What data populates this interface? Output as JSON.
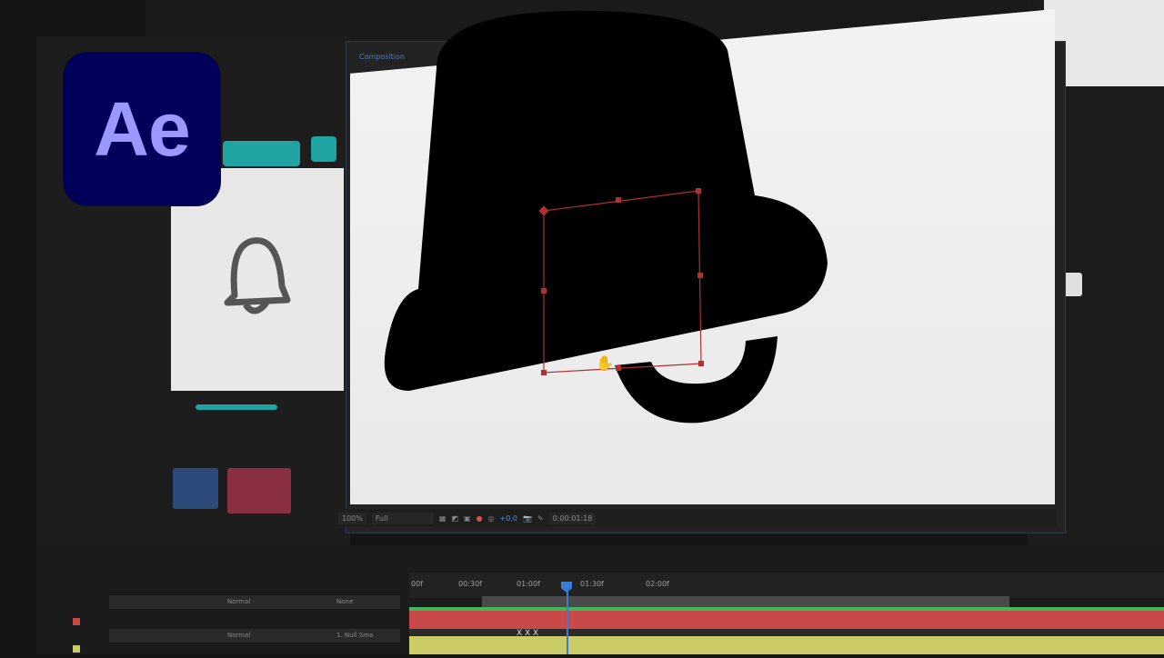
{
  "app": {
    "logo_text": "Ae",
    "logo_bg": "#00005b",
    "logo_fg": "#9999ff"
  },
  "composition": {
    "tab_label": "Composition",
    "footer": {
      "zoom": "100%",
      "resolution": "Full",
      "exposure": "+0,0",
      "timecode": "0:00:01:18"
    }
  },
  "timeline": {
    "ruler_labels": [
      "00f",
      "00:30f",
      "01:00f",
      "01:30f",
      "02:00f"
    ],
    "layers": [
      {
        "mode": "Normal",
        "parent": "None",
        "color": "#c94848"
      },
      {
        "mode": "Normal",
        "parent": "1. Null Sma",
        "color": "#cccc66"
      }
    ],
    "keyframe_markers": "X X X"
  },
  "colors": {
    "accent_teal": "#1fa3a3",
    "playhead": "#3a7bd5",
    "track_red": "#c94848",
    "track_green": "#3dbb5a",
    "track_yellow": "#cccc66",
    "selection": "#b03030"
  }
}
